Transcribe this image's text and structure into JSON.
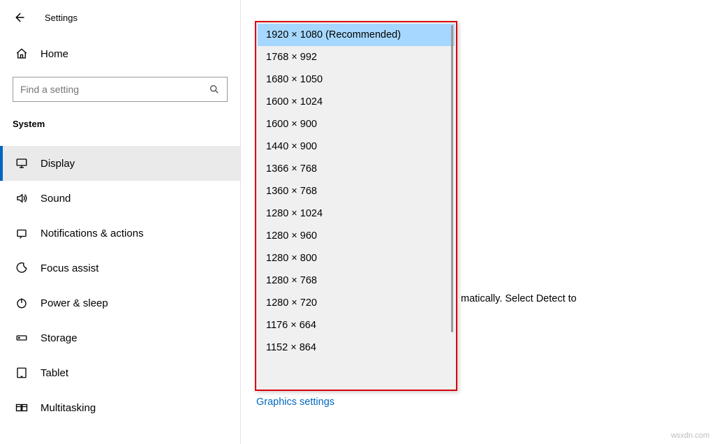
{
  "header": {
    "title": "Settings"
  },
  "home": {
    "label": "Home"
  },
  "search": {
    "placeholder": "Find a setting"
  },
  "section": {
    "label": "System"
  },
  "nav": [
    {
      "label": "Display",
      "active": true
    },
    {
      "label": "Sound",
      "active": false
    },
    {
      "label": "Notifications & actions",
      "active": false
    },
    {
      "label": "Focus assist",
      "active": false
    },
    {
      "label": "Power & sleep",
      "active": false
    },
    {
      "label": "Storage",
      "active": false
    },
    {
      "label": "Tablet",
      "active": false
    },
    {
      "label": "Multitasking",
      "active": false
    }
  ],
  "resolution_dropdown": {
    "selected_index": 0,
    "options": [
      "1920 × 1080 (Recommended)",
      "1768 × 992",
      "1680 × 1050",
      "1600 × 1024",
      "1600 × 900",
      "1440 × 900",
      "1366 × 768",
      "1360 × 768",
      "1280 × 1024",
      "1280 × 960",
      "1280 × 800",
      "1280 × 768",
      "1280 × 720",
      "1176 × 664",
      "1152 × 864"
    ]
  },
  "partial_text": "matically. Select Detect to",
  "graphics_link": "Graphics settings",
  "watermark": "wsxdn.com"
}
